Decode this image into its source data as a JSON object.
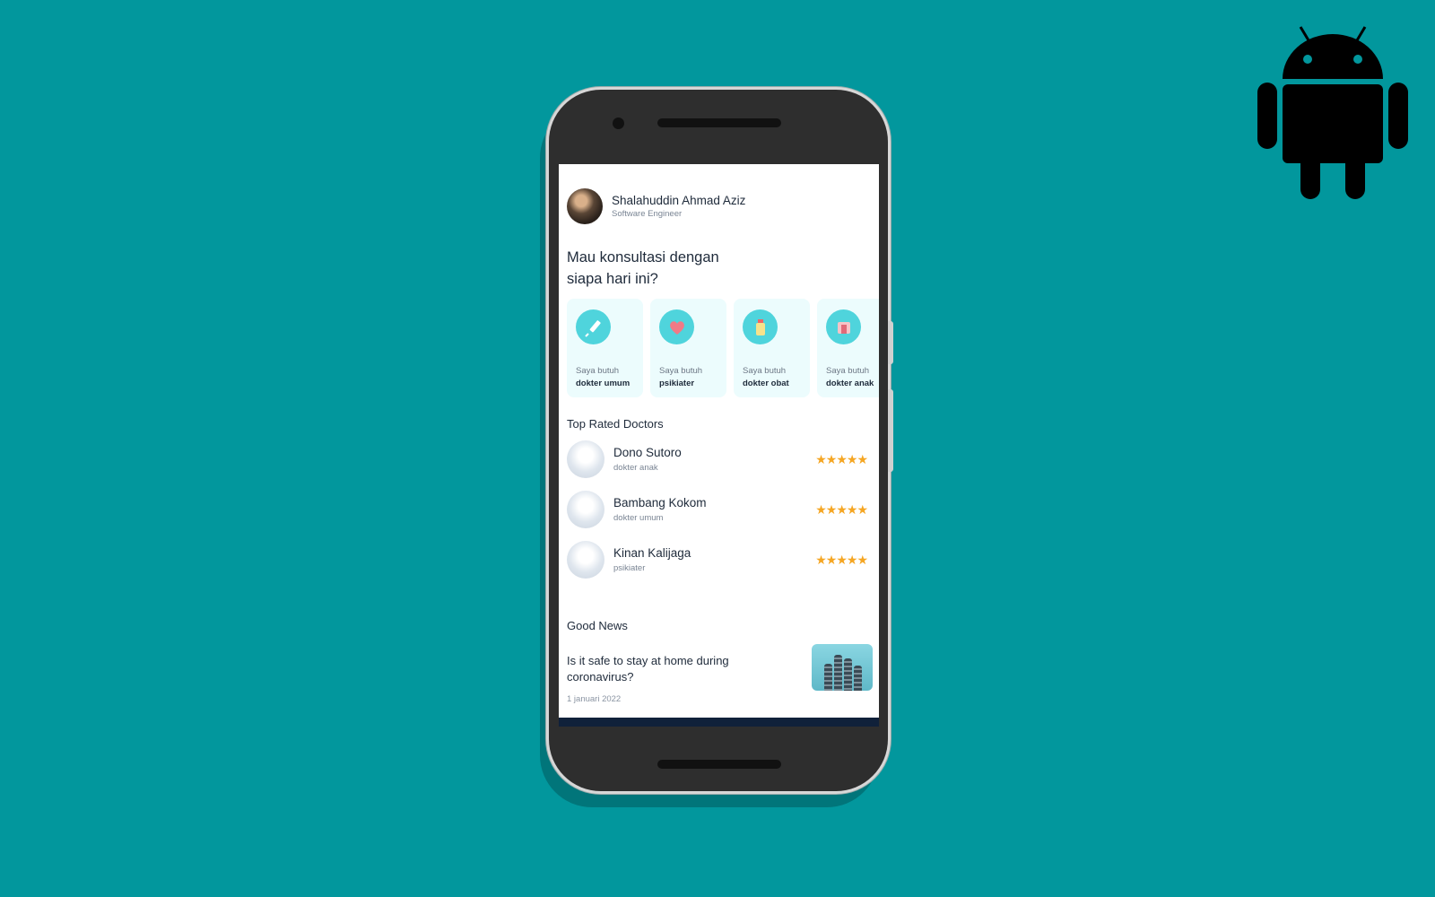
{
  "profile": {
    "name": "Shalahuddin Ahmad Aziz",
    "role": "Software Engineer"
  },
  "headline": "Mau konsultasi dengan siapa hari ini?",
  "categories": [
    {
      "line1": "Saya butuh",
      "line2": "dokter umum",
      "icon": "syringe-icon"
    },
    {
      "line1": "Saya butuh",
      "line2": "psikiater",
      "icon": "heart-icon"
    },
    {
      "line1": "Saya butuh",
      "line2": "dokter obat",
      "icon": "medicine-bottle-icon"
    },
    {
      "line1": "Saya butuh",
      "line2": "dokter anak",
      "icon": "baby-icon"
    }
  ],
  "sections": {
    "top_rated": "Top Rated Doctors",
    "news": "Good News"
  },
  "doctors": [
    {
      "name": "Dono Sutoro",
      "specialty": "dokter anak",
      "rating": 5
    },
    {
      "name": "Bambang Kokom",
      "specialty": "dokter umum",
      "rating": 5
    },
    {
      "name": "Kinan Kalijaga",
      "specialty": "psikiater",
      "rating": 5
    }
  ],
  "news": {
    "title": "Is it safe to stay at home during coronavirus?",
    "date": "1 januari 2022"
  },
  "colors": {
    "background": "#02979d",
    "accent": "#4fd4dc",
    "card": "#ecfcfd",
    "star": "#f5a623"
  }
}
